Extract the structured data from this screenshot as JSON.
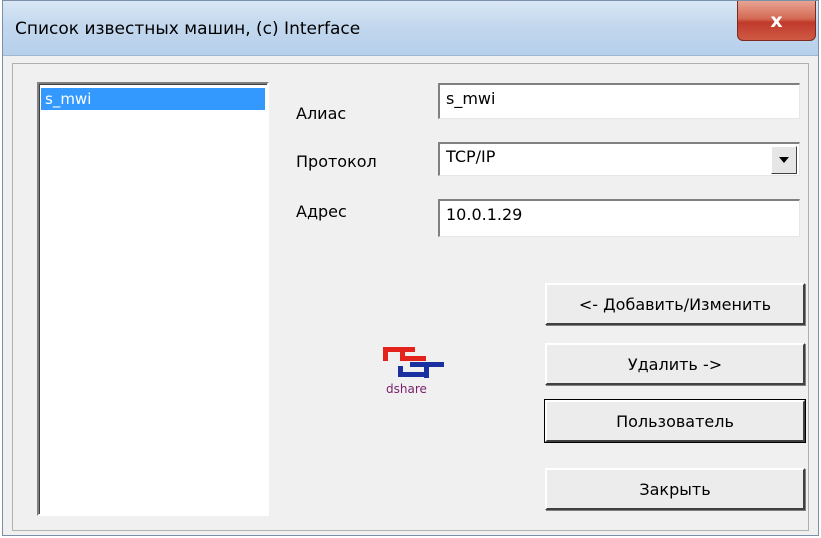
{
  "window": {
    "title": "Список известных машин, (c) Interface",
    "close_glyph": "x"
  },
  "machine_list": {
    "items": [
      "s_mwi"
    ],
    "selected_index": 0
  },
  "form": {
    "alias_label": "Алиас",
    "alias_value": "s_mwi",
    "protocol_label": "Протокол",
    "protocol_value": "TCP/IP",
    "address_label": "Адрес",
    "address_value": "10.0.1.29"
  },
  "buttons": {
    "add_change": "<- Добавить/Изменить",
    "delete": "Удалить ->",
    "user": "Пользователь",
    "close": "Закрыть"
  },
  "logo": {
    "text": "dshare",
    "colors": {
      "red": "#e3231b",
      "blue": "#1a2fa0",
      "text": "#7a1f6b"
    }
  },
  "icons": {
    "dropdown": "chevron-down-icon",
    "close": "close-icon"
  }
}
